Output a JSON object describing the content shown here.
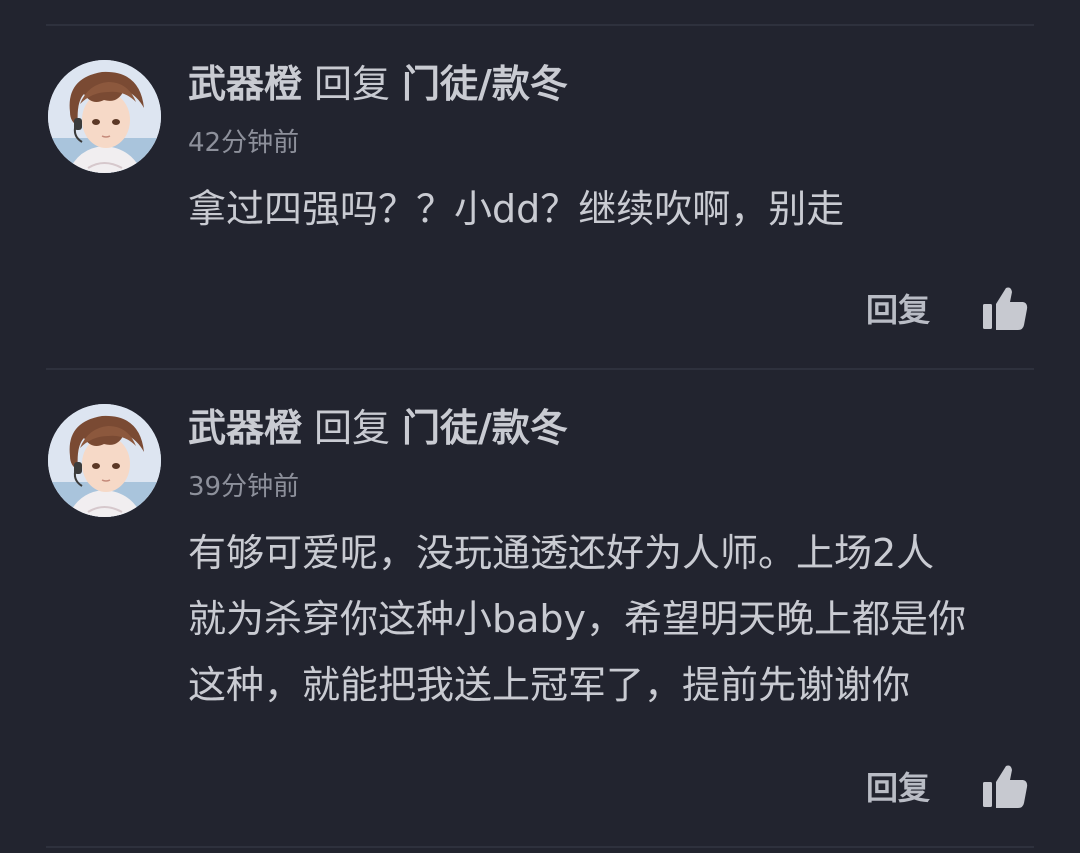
{
  "comments": [
    {
      "username": "武器橙",
      "reply_word": "回复",
      "target_user": "门徒/款冬",
      "time": "42分钟前",
      "text": "拿过四强吗？？小dd？继续吹啊，别走",
      "reply_label": "回复",
      "avatar_icon": "anime-boy-avatar",
      "like_icon": "thumbs-up-icon"
    },
    {
      "username": "武器橙",
      "reply_word": "回复",
      "target_user": "门徒/款冬",
      "time": "39分钟前",
      "text": "有够可爱呢，没玩通透还好为人师。上场2人\n就为杀穿你这种小baby，希望明天晚上都是你\n这种，就能把我送上冠军了，提前先谢谢你",
      "reply_label": "回复",
      "avatar_icon": "anime-boy-avatar",
      "like_icon": "thumbs-up-icon"
    }
  ],
  "colors": {
    "background": "#22242f",
    "divider": "#2e313d",
    "text": "#c9cbd2",
    "meta": "#8d909b",
    "icon": "#c7c9d0"
  }
}
